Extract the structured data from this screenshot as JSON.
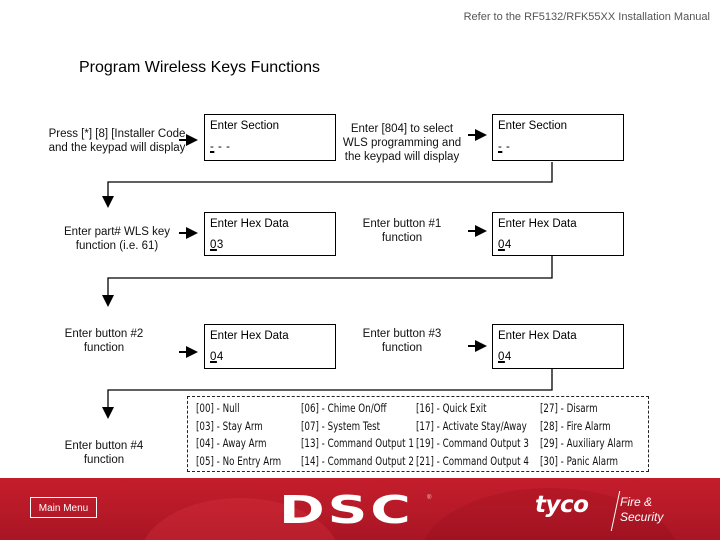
{
  "header": {
    "reference_note": "Refer to the RF5132/RFK55XX  Installation Manual",
    "title": "Program Wireless Keys Functions"
  },
  "steps": [
    {
      "instruction": "Press [*] [8] [Installer Code and the keypad will display",
      "display_title": "Enter Section",
      "display_value_cursor": "-",
      "display_value_rest": " - -"
    },
    {
      "instruction": "Enter [804] to select WLS programming and the keypad will display",
      "display_title": "Enter Section",
      "display_value_cursor": "-",
      "display_value_rest": " -"
    },
    {
      "instruction": "Enter part# WLS key function (i.e. 61)",
      "display_title": "Enter Hex Data",
      "display_value_cursor": "0",
      "display_value_rest": "3"
    },
    {
      "instruction": "Enter button #1 function",
      "display_title": "Enter Hex Data",
      "display_value_cursor": "0",
      "display_value_rest": "4"
    },
    {
      "instruction": "Enter button #2 function",
      "display_title": "Enter Hex Data",
      "display_value_cursor": "0",
      "display_value_rest": "4"
    },
    {
      "instruction": "Enter button #3 function",
      "display_title": "Enter Hex Data",
      "display_value_cursor": "0",
      "display_value_rest": "4"
    },
    {
      "instruction": "Enter button #4 function"
    }
  ],
  "function_codes": [
    [
      "[00] - Null",
      "[03] - Stay Arm",
      "[04] - Away Arm",
      "[05] - No Entry Arm"
    ],
    [
      "[06] - Chime On/Off",
      "[07] - System Test",
      "[13] - Command Output 1",
      "[14] - Command Output 2"
    ],
    [
      "[16] - Quick Exit",
      "[17] - Activate Stay/Away",
      "[19] - Command Output 3",
      "[21] - Command Output 4"
    ],
    [
      "[27] - Disarm",
      "[28] - Fire Alarm",
      "[29] - Auxiliary Alarm",
      "[30] - Panic Alarm"
    ]
  ],
  "footer": {
    "main_menu_label": "Main Menu",
    "brand_logo": "DSC",
    "brand_reg": "®",
    "partner_logo": "tyco",
    "partner_line1": "Fire &",
    "partner_line2": "Security",
    "background_color": "#c01c2b"
  }
}
